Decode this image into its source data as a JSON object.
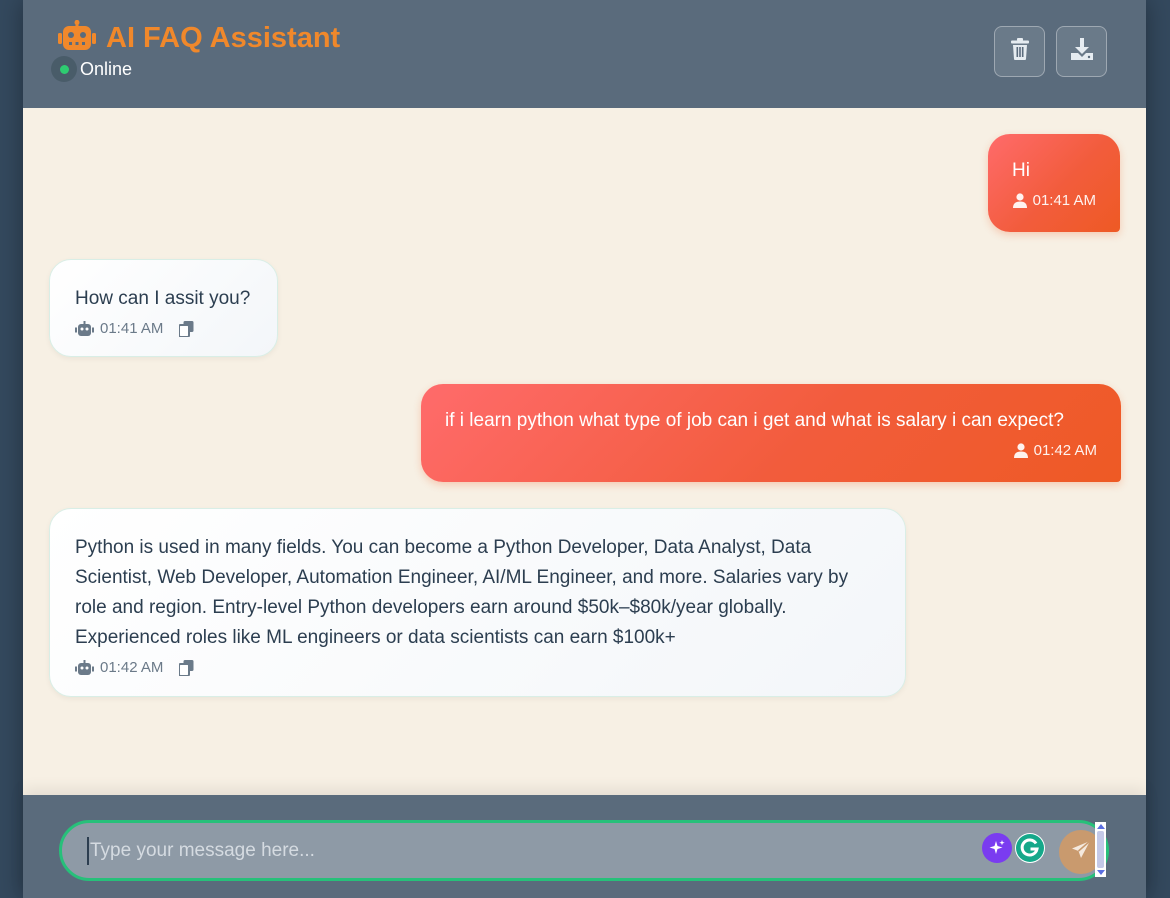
{
  "header": {
    "title": "AI FAQ Assistant",
    "status": "Online",
    "status_color": "#2ecc71",
    "title_color": "#f0882b",
    "icons": {
      "brand": "robot-icon",
      "clear": "trash-icon",
      "export": "download-icon"
    }
  },
  "messages": [
    {
      "role": "user",
      "text": "Hi",
      "time": "01:41 AM"
    },
    {
      "role": "bot",
      "text": "How can I assit you?",
      "time": "01:41 AM"
    },
    {
      "role": "user",
      "text": "if i learn python what type of job can i get and what is salary i can expect?",
      "time": "01:42 AM"
    },
    {
      "role": "bot",
      "text": "Python is used in many fields. You can become a Python Developer, Data Analyst, Data Scientist, Web Developer, Automation Engineer, AI/ML Engineer, and more. Salaries vary by role and region. Entry-level Python developers earn around $50k–$80k/year globally. Experienced roles like ML engineers or data scientists can earn $100k+",
      "time": "01:42 AM"
    }
  ],
  "input": {
    "placeholder": "Type your message here...",
    "value": ""
  },
  "colors": {
    "user_bubble": "#ff6b6b",
    "user_bubble_end": "#ee5a24",
    "chat_bg": "#f7f0e4",
    "header_bg": "#5a6b7c",
    "input_border": "#27c07a"
  }
}
